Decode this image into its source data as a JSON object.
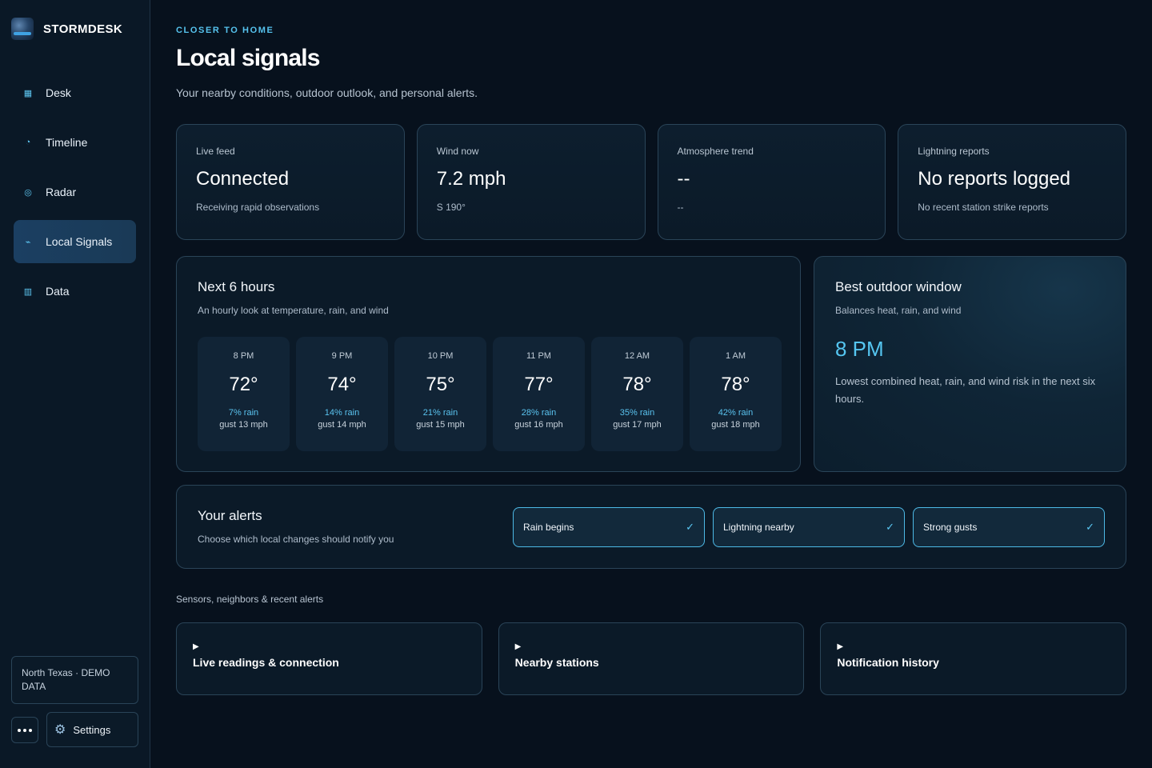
{
  "app": {
    "name": "STORMDESK"
  },
  "nav": {
    "items": [
      {
        "label": "Desk",
        "icon": "grid-icon",
        "glyph": "▦",
        "active": false
      },
      {
        "label": "Timeline",
        "icon": "clock-icon",
        "glyph": "◔",
        "active": false
      },
      {
        "label": "Radar",
        "icon": "radar-icon",
        "glyph": "◎",
        "active": false
      },
      {
        "label": "Local Signals",
        "icon": "lightning-icon",
        "glyph": "⌁",
        "active": true
      },
      {
        "label": "Data",
        "icon": "table-icon",
        "glyph": "▥",
        "active": false
      }
    ]
  },
  "sidebar_footer": {
    "region": "North Texas · DEMO DATA",
    "settings_label": "Settings",
    "settings_glyph": "⚙"
  },
  "header": {
    "eyebrow": "CLOSER TO HOME",
    "title": "Local signals",
    "subtitle": "Your nearby conditions, outdoor outlook, and personal alerts."
  },
  "stats": [
    {
      "label": "Live feed",
      "value": "Connected",
      "sub": "Receiving rapid observations"
    },
    {
      "label": "Wind now",
      "value": "7.2 mph",
      "sub": "S 190°"
    },
    {
      "label": "Atmosphere trend",
      "value": "--",
      "sub": "--"
    },
    {
      "label": "Lightning reports",
      "value": "No reports logged",
      "sub": "No recent station strike reports"
    }
  ],
  "forecast": {
    "title": "Next 6 hours",
    "subtitle": "An hourly look at temperature, rain, and wind",
    "hours": [
      {
        "time": "8 PM",
        "temp": "72°",
        "rain": "7% rain",
        "gust": "gust 13 mph"
      },
      {
        "time": "9 PM",
        "temp": "74°",
        "rain": "14% rain",
        "gust": "gust 14 mph"
      },
      {
        "time": "10 PM",
        "temp": "75°",
        "rain": "21% rain",
        "gust": "gust 15 mph"
      },
      {
        "time": "11 PM",
        "temp": "77°",
        "rain": "28% rain",
        "gust": "gust 16 mph"
      },
      {
        "time": "12 AM",
        "temp": "78°",
        "rain": "35% rain",
        "gust": "gust 17 mph"
      },
      {
        "time": "1 AM",
        "temp": "78°",
        "rain": "42% rain",
        "gust": "gust 18 mph"
      }
    ]
  },
  "best_window": {
    "title": "Best outdoor window",
    "subtitle": "Balances heat, rain, and wind",
    "time": "8 PM",
    "description": "Lowest combined heat, rain, and wind risk in the next six hours."
  },
  "alerts": {
    "title": "Your alerts",
    "subtitle": "Choose which local changes should notify you",
    "toggles": [
      {
        "label": "Rain begins",
        "checked": true,
        "check": "✓"
      },
      {
        "label": "Lightning nearby",
        "checked": true,
        "check": "✓"
      },
      {
        "label": "Strong gusts",
        "checked": true,
        "check": "✓"
      }
    ]
  },
  "details": {
    "section_label": "Sensors, neighbors & recent alerts",
    "caret": "▶",
    "items": [
      {
        "label": "Live readings & connection"
      },
      {
        "label": "Nearby stations"
      },
      {
        "label": "Notification history"
      }
    ]
  },
  "colors": {
    "background": "#07111d",
    "accent": "#56c3ee",
    "active_nav": "#1b3f62",
    "card_border": "#2a4458"
  }
}
